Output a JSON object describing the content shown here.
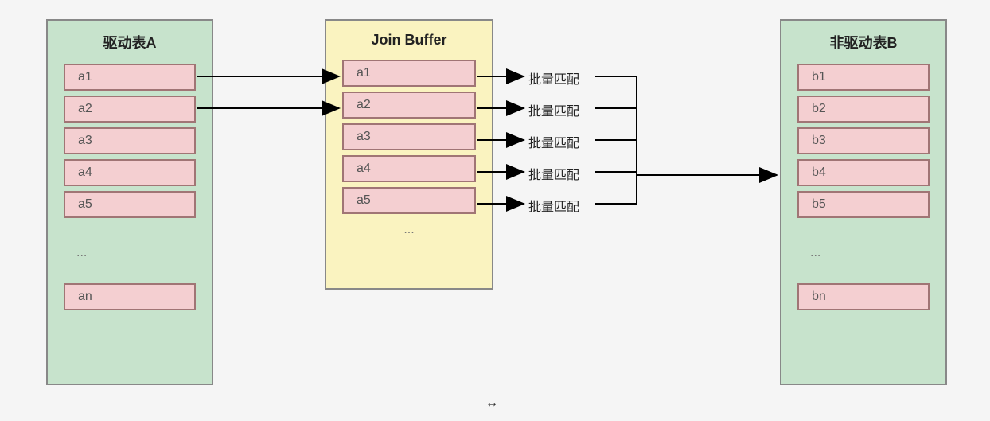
{
  "tableA": {
    "title": "驱动表A",
    "rows": [
      "a1",
      "a2",
      "a3",
      "a4",
      "a5"
    ],
    "ellipsis": "...",
    "last": "an"
  },
  "buffer": {
    "title": "Join Buffer",
    "rows": [
      "a1",
      "a2",
      "a3",
      "a4",
      "a5"
    ],
    "ellipsis": "..."
  },
  "tableB": {
    "title": "非驱动表B",
    "rows": [
      "b1",
      "b2",
      "b3",
      "b4",
      "b5"
    ],
    "ellipsis": "...",
    "last": "bn"
  },
  "matchLabels": [
    "批量匹配",
    "批量匹配",
    "批量匹配",
    "批量匹配",
    "批量匹配"
  ],
  "resizeCue": "↔"
}
